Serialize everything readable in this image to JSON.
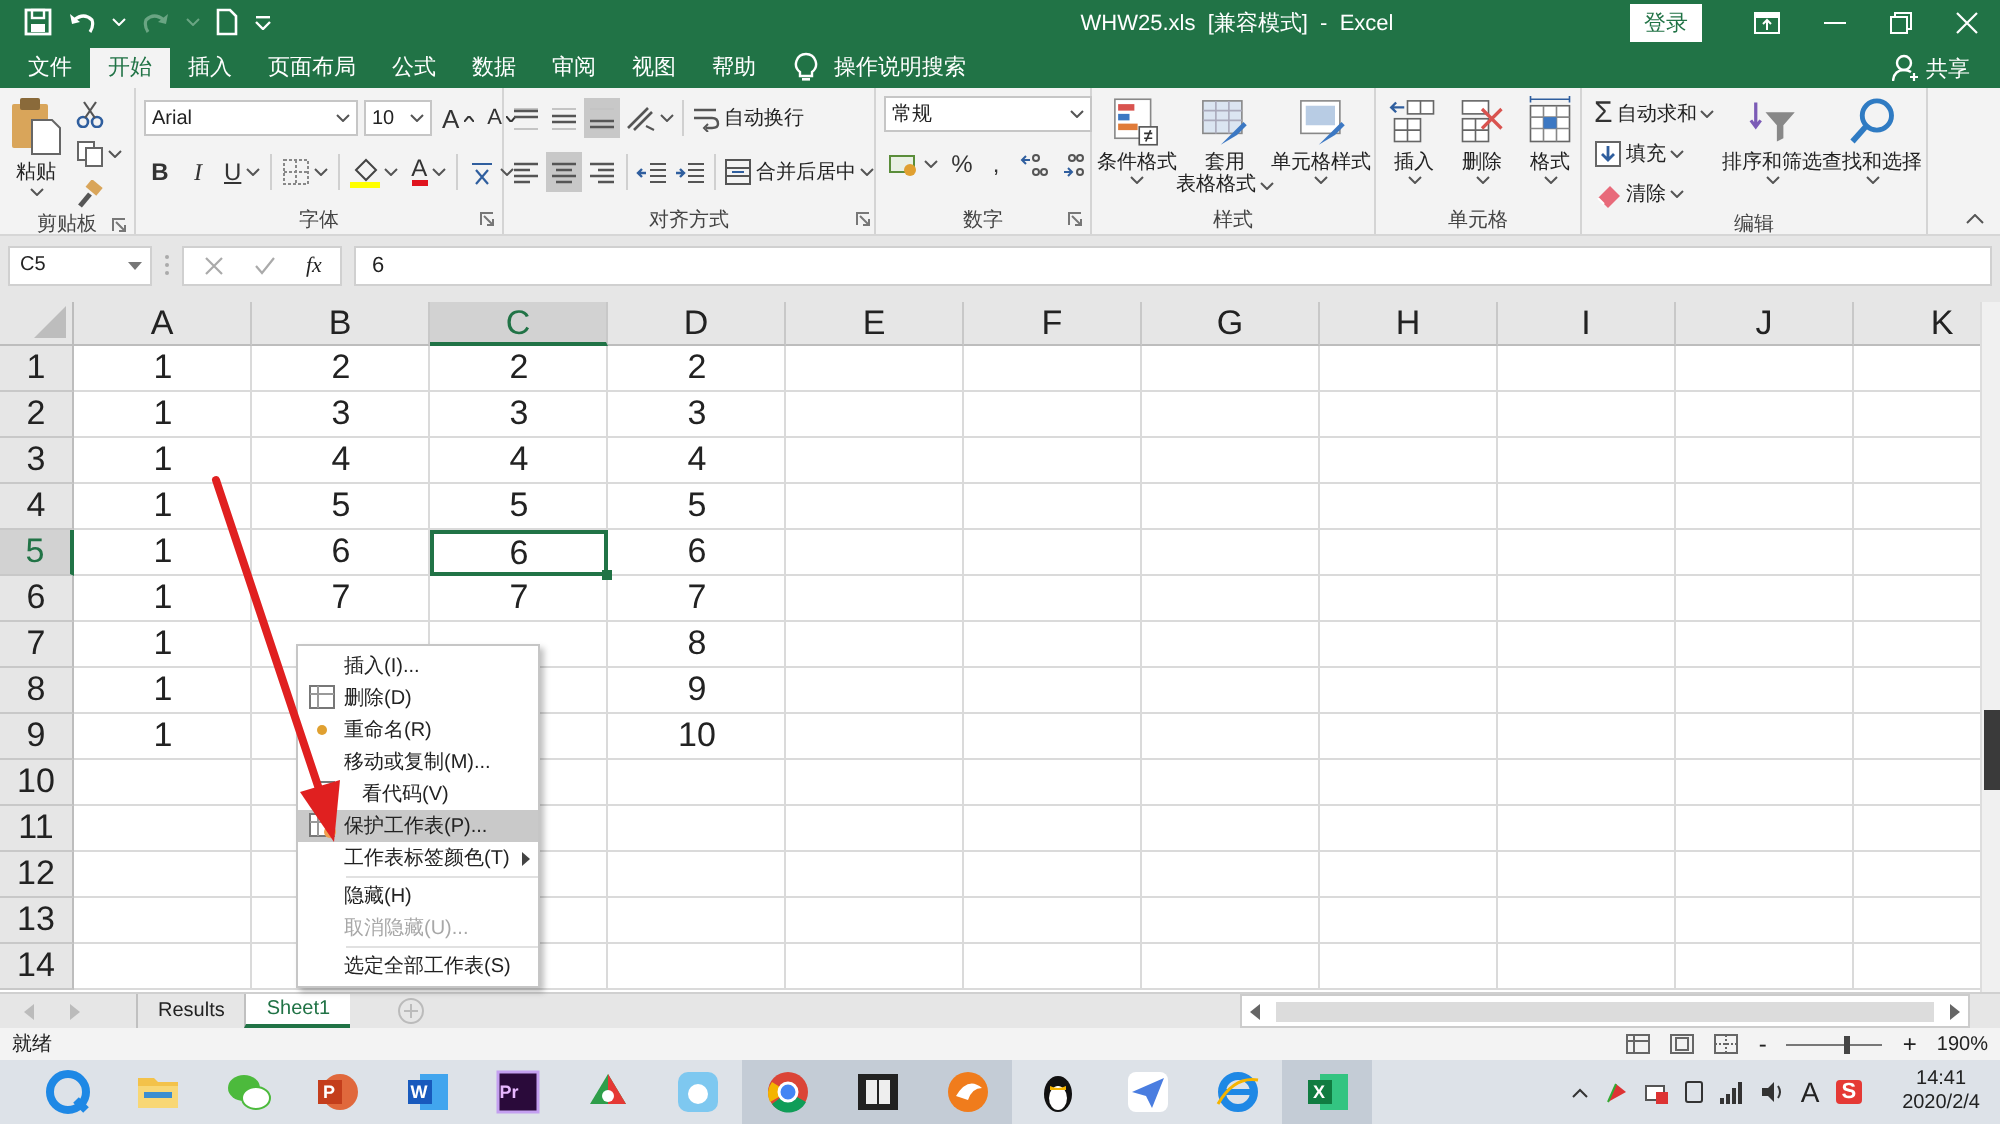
{
  "window": {
    "title": "WHW25.xls  [兼容模式]  -  Excel",
    "login_button": "登录"
  },
  "menu_tabs": [
    {
      "label": "文件",
      "selected": false
    },
    {
      "label": "开始",
      "selected": true
    },
    {
      "label": "插入",
      "selected": false
    },
    {
      "label": "页面布局",
      "selected": false
    },
    {
      "label": "公式",
      "selected": false
    },
    {
      "label": "数据",
      "selected": false
    },
    {
      "label": "审阅",
      "selected": false
    },
    {
      "label": "视图",
      "selected": false
    },
    {
      "label": "帮助",
      "selected": false
    }
  ],
  "tell_me": "操作说明搜索",
  "share": "共享",
  "ribbon": {
    "clipboard": {
      "label": "剪贴板",
      "paste": "粘贴"
    },
    "font": {
      "label": "字体",
      "font_name": "Arial",
      "font_size": "10",
      "grow": "A",
      "shrink": "A",
      "bold": "B",
      "italic": "I",
      "underline": "U",
      "font_color": "A"
    },
    "alignment": {
      "label": "对齐方式",
      "wrap_text": "自动换行",
      "merge_center": "合并后居中",
      "vertical_align": [
        {
          "selected": false
        },
        {
          "selected": false
        },
        {
          "selected": true
        }
      ],
      "horizontal_align": [
        {
          "selected": false
        },
        {
          "selected": true
        },
        {
          "selected": false
        }
      ]
    },
    "number": {
      "label": "数字",
      "format": "常规",
      "percent": "%",
      "comma": ","
    },
    "styles": {
      "label": "样式",
      "buttons": [
        {
          "lines": [
            "条件格式"
          ]
        },
        {
          "lines": [
            "套用",
            "表格格式"
          ]
        },
        {
          "lines": [
            "单元格样式"
          ]
        }
      ]
    },
    "cells": {
      "label": "单元格",
      "buttons": [
        {
          "lines": [
            "插入"
          ]
        },
        {
          "lines": [
            "删除"
          ]
        },
        {
          "lines": [
            "格式"
          ]
        }
      ]
    },
    "editing": {
      "label": "编辑",
      "autosum_symbol": "Σ",
      "autosum": "自动求和",
      "fill": "填充",
      "clear": "清除",
      "sort_filter": "排序和筛选",
      "find_select": "查找和选择"
    }
  },
  "formula_bar": {
    "name_box": "C5",
    "fx": "fx",
    "value": "6"
  },
  "sheet": {
    "columns": [
      {
        "label": "A",
        "selected": false
      },
      {
        "label": "B",
        "selected": false
      },
      {
        "label": "C",
        "selected": true
      },
      {
        "label": "D",
        "selected": false
      },
      {
        "label": "E",
        "selected": false
      },
      {
        "label": "F",
        "selected": false
      },
      {
        "label": "G",
        "selected": false
      },
      {
        "label": "H",
        "selected": false
      },
      {
        "label": "I",
        "selected": false
      },
      {
        "label": "J",
        "selected": false
      },
      {
        "label": "K",
        "selected": false
      }
    ],
    "rows": [
      {
        "label": "1",
        "selected": false,
        "cells": [
          "1",
          "2",
          "2",
          "2"
        ]
      },
      {
        "label": "2",
        "selected": false,
        "cells": [
          "1",
          "3",
          "3",
          "3"
        ]
      },
      {
        "label": "3",
        "selected": false,
        "cells": [
          "1",
          "4",
          "4",
          "4"
        ]
      },
      {
        "label": "4",
        "selected": false,
        "cells": [
          "1",
          "5",
          "5",
          "5"
        ]
      },
      {
        "label": "5",
        "selected": true,
        "cells": [
          "1",
          "6",
          "6",
          "6"
        ]
      },
      {
        "label": "6",
        "selected": false,
        "cells": [
          "1",
          "7",
          "7",
          "7"
        ]
      },
      {
        "label": "7",
        "selected": false,
        "cells": [
          "1",
          null,
          null,
          "8"
        ]
      },
      {
        "label": "8",
        "selected": false,
        "cells": [
          "1",
          null,
          null,
          "9"
        ]
      },
      {
        "label": "9",
        "selected": false,
        "cells": [
          "1",
          null,
          null,
          "10"
        ]
      },
      {
        "label": "10",
        "selected": false
      },
      {
        "label": "11",
        "selected": false
      },
      {
        "label": "12",
        "selected": false
      },
      {
        "label": "13",
        "selected": false
      },
      {
        "label": "14",
        "selected": false
      }
    ]
  },
  "context_menu": [
    {
      "kind": "item",
      "label": "插入(I)...",
      "selected": false,
      "disabled": false
    },
    {
      "kind": "item",
      "label": "删除(D)",
      "selected": false,
      "disabled": false
    },
    {
      "kind": "item",
      "label": "重命名(R)",
      "selected": false,
      "disabled": false
    },
    {
      "kind": "item",
      "label": "移动或复制(M)...",
      "selected": false,
      "disabled": false
    },
    {
      "kind": "item",
      "label": "看代码(V)",
      "selected": false,
      "disabled": false
    },
    {
      "kind": "item",
      "label": "保护工作表(P)...",
      "selected": true,
      "disabled": false
    },
    {
      "kind": "submenu",
      "label": "工作表标签颜色(T)",
      "selected": false,
      "disabled": false
    },
    {
      "kind": "separator"
    },
    {
      "kind": "item",
      "label": "隐藏(H)",
      "selected": false,
      "disabled": false
    },
    {
      "kind": "item",
      "label": "取消隐藏(U)...",
      "selected": false,
      "disabled": true
    },
    {
      "kind": "separator"
    },
    {
      "kind": "item",
      "label": "选定全部工作表(S)",
      "selected": false,
      "disabled": false
    }
  ],
  "sheet_tabs": [
    {
      "label": "Results",
      "selected": false
    },
    {
      "label": "Sheet1",
      "selected": true
    }
  ],
  "status_bar": {
    "text": "就绪",
    "zoom_minus": "-",
    "zoom_plus": "+",
    "zoom": "190%",
    "zoom_slider": {
      "level": 0.62
    }
  },
  "taskbar": {
    "apps": [
      {
        "running": false
      },
      {
        "running": false
      },
      {
        "running": false
      },
      {
        "running": false,
        "glyph": "P"
      },
      {
        "running": false,
        "glyph": "W"
      },
      {
        "running": false,
        "glyph": "Pr"
      },
      {
        "running": false
      },
      {
        "running": false
      },
      {
        "running": true
      },
      {
        "running": true
      },
      {
        "running": true
      },
      {
        "running": false
      },
      {
        "running": false
      },
      {
        "running": false
      },
      {
        "running": true,
        "glyph": "X"
      }
    ],
    "ime": "A",
    "sogou": "S",
    "time": "14:41",
    "date": "2020/2/4"
  }
}
